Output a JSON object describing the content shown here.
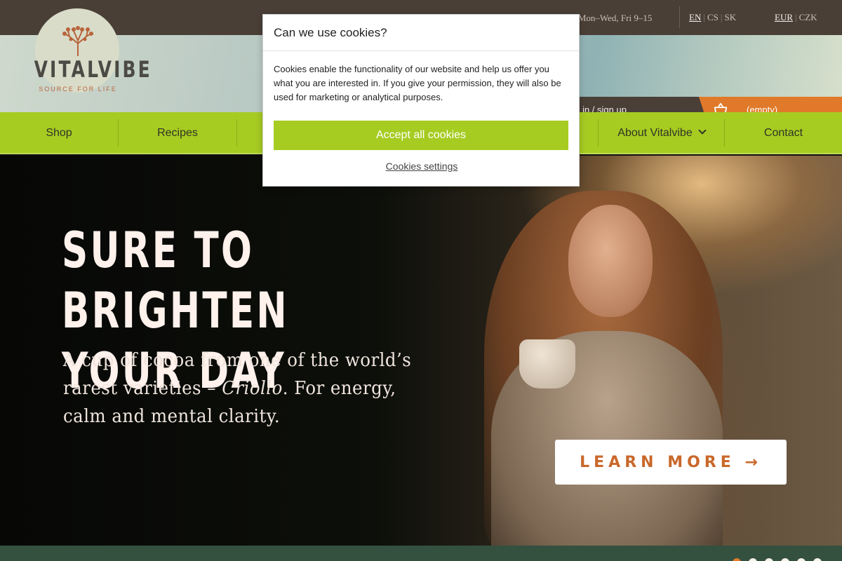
{
  "topbar": {
    "hours_partial": "| Mon–Wed, Fri 9–15",
    "languages": [
      "EN",
      "CS",
      "SK"
    ],
    "active_language": "EN",
    "currencies": [
      "EUR",
      "CZK"
    ],
    "active_currency": "EUR"
  },
  "logo": {
    "name": "VITALVIBE",
    "tagline": "SOURCE FOR LIFE"
  },
  "header": {
    "signin_label": "gn in / sign up",
    "cart_label": "(empty)"
  },
  "nav": {
    "items": [
      "Shop",
      "Recipes",
      "About Vitalvibe",
      "Contact"
    ]
  },
  "hero": {
    "title_line1": "SURE TO BRIGHTEN",
    "title_line2": "YOUR DAY",
    "text_before": "A cup of cocoa from one of the world’s rarest varieties – ",
    "text_italic": "Criollo",
    "text_after": ". For energy, calm and mental clarity.",
    "cta_label": "LEARN MORE →"
  },
  "slider": {
    "count": 6,
    "active_index": 0
  },
  "cookie_modal": {
    "title": "Can we use cookies?",
    "body": "Cookies enable the functionality of our website and help us offer you what you are interested in. If you give your permission, they will also be used for marketing or analytical purposes.",
    "accept_label": "Accept all cookies",
    "settings_label": "Cookies settings"
  },
  "colors": {
    "brand_green": "#a6cc22",
    "brand_orange": "#e07a2a",
    "dark_brown": "#4a3f37"
  }
}
